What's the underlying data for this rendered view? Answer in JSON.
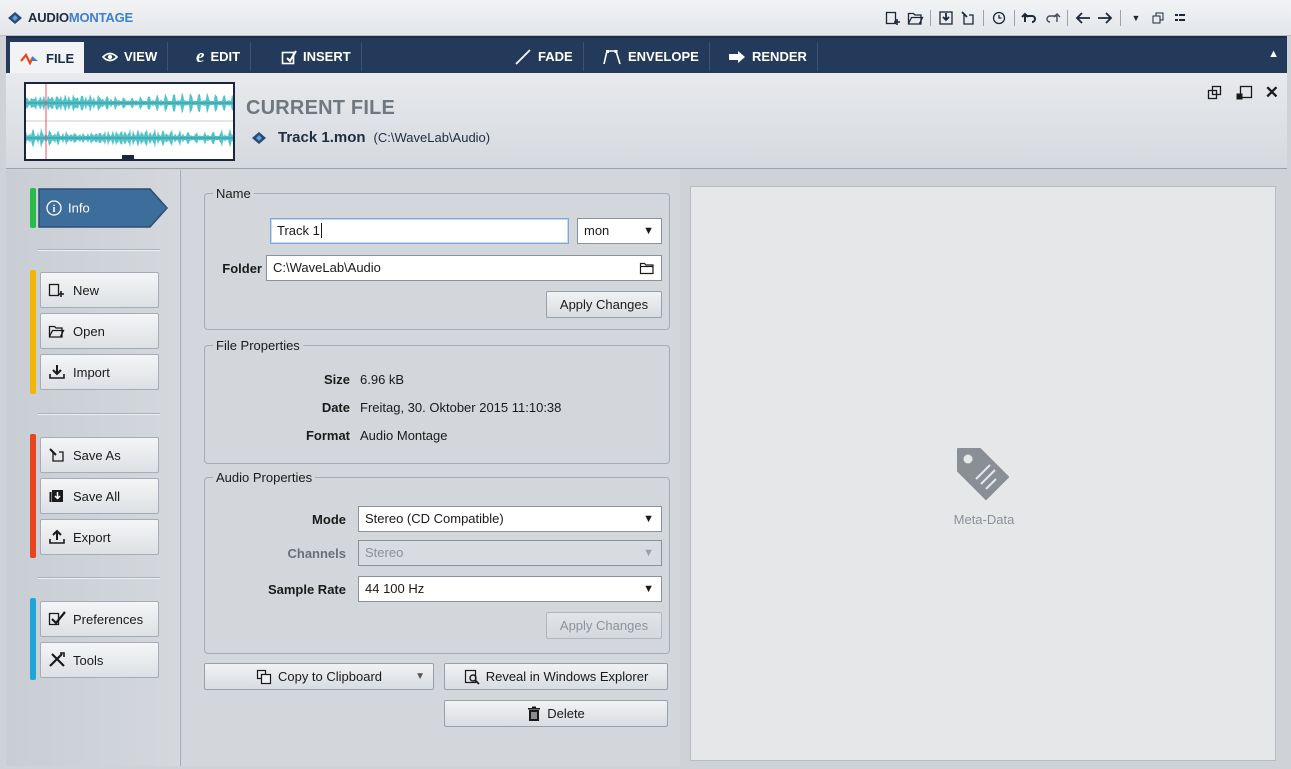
{
  "app": {
    "title_part1": "AUDIO",
    "title_part2": "MONTAGE",
    "logo_icon": "audio-montage-logo"
  },
  "quick_access": [
    "new-icon",
    "open-icon",
    "save-icon",
    "save-as-icon",
    "history-icon",
    "undo-icon",
    "redo-icon",
    "back-icon",
    "forward-icon",
    "dropdown-icon",
    "restore-icon",
    "layout-icon"
  ],
  "tabs": [
    {
      "label": "FILE",
      "icon": "file-icon",
      "active": true
    },
    {
      "label": "VIEW",
      "icon": "eye-icon",
      "active": false
    },
    {
      "label": "EDIT",
      "icon": "edit-icon",
      "active": false
    },
    {
      "label": "INSERT",
      "icon": "insert-icon",
      "active": false
    },
    {
      "label": "FADE",
      "icon": "fade-icon",
      "active": false
    },
    {
      "label": "ENVELOPE",
      "icon": "envelope-icon",
      "active": false
    },
    {
      "label": "RENDER",
      "icon": "render-icon",
      "active": false
    }
  ],
  "ribbon": {
    "heading": "CURRENT FILE",
    "file_name": "Track 1.mon",
    "file_path": "(C:\\WaveLab\\Audio)"
  },
  "sidebar": {
    "info": "Info",
    "new": "New",
    "open": "Open",
    "import": "Import",
    "save_as": "Save As",
    "save_all": "Save All",
    "export": "Export",
    "preferences": "Preferences",
    "tools": "Tools"
  },
  "name_group": {
    "legend": "Name",
    "name_value": "Track 1",
    "extension": "mon",
    "folder_label": "Folder",
    "folder_value": "C:\\WaveLab\\Audio",
    "apply": "Apply Changes"
  },
  "file_props": {
    "legend": "File Properties",
    "size_label": "Size",
    "size_value": "6.96 kB",
    "date_label": "Date",
    "date_value": "Freitag, 30. Oktober 2015 11:10:38",
    "format_label": "Format",
    "format_value": "Audio Montage"
  },
  "audio_props": {
    "legend": "Audio Properties",
    "mode_label": "Mode",
    "mode_value": "Stereo (CD Compatible)",
    "channels_label": "Channels",
    "channels_value": "Stereo",
    "rate_label": "Sample Rate",
    "rate_value": "44 100 Hz",
    "apply": "Apply Changes"
  },
  "actions": {
    "copy": "Copy to Clipboard",
    "reveal": "Reveal in Windows Explorer",
    "delete": "Delete"
  },
  "meta": {
    "label": "Meta-Data",
    "icon": "tag-icon"
  },
  "colors": {
    "tab_bar": "#243a5a",
    "accent_blue": "#3d7fd0",
    "group_green": "#2db84a",
    "group_yellow": "#f2b705",
    "group_red": "#e8441e",
    "group_cyan": "#1fa6d6",
    "waveform": "#4fc3c8"
  }
}
